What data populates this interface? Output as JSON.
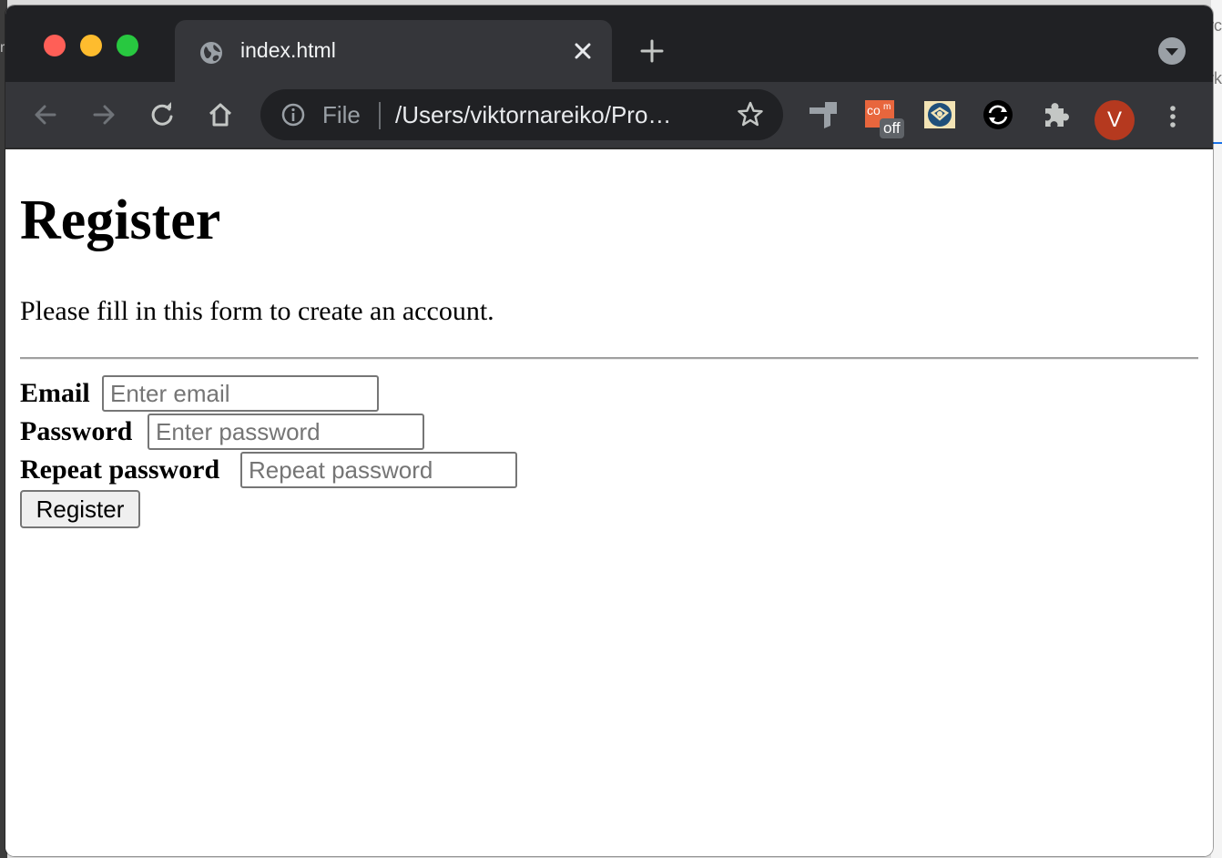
{
  "browser": {
    "tab": {
      "title": "index.html"
    },
    "omnibox": {
      "scheme_label": "File",
      "url": "/Users/viktornareiko/Pro…"
    },
    "extensions": [
      {
        "icon": "bookmark-extension-icon"
      },
      {
        "icon": "com-extension-icon",
        "badge": "off"
      },
      {
        "icon": "translate-extension-icon"
      },
      {
        "icon": "sync-extension-icon"
      },
      {
        "icon": "puzzle-icon"
      }
    ],
    "profile": {
      "initial": "V",
      "color": "#b5391f"
    }
  },
  "page": {
    "title": "Register",
    "subtitle": "Please fill in this form to create an account.",
    "form": {
      "email": {
        "label": "Email",
        "placeholder": "Enter email",
        "value": ""
      },
      "password": {
        "label": "Password",
        "placeholder": "Enter password",
        "value": ""
      },
      "repeat_password": {
        "label": "Repeat password",
        "placeholder": "Repeat password",
        "value": ""
      },
      "submit_label": "Register"
    }
  }
}
